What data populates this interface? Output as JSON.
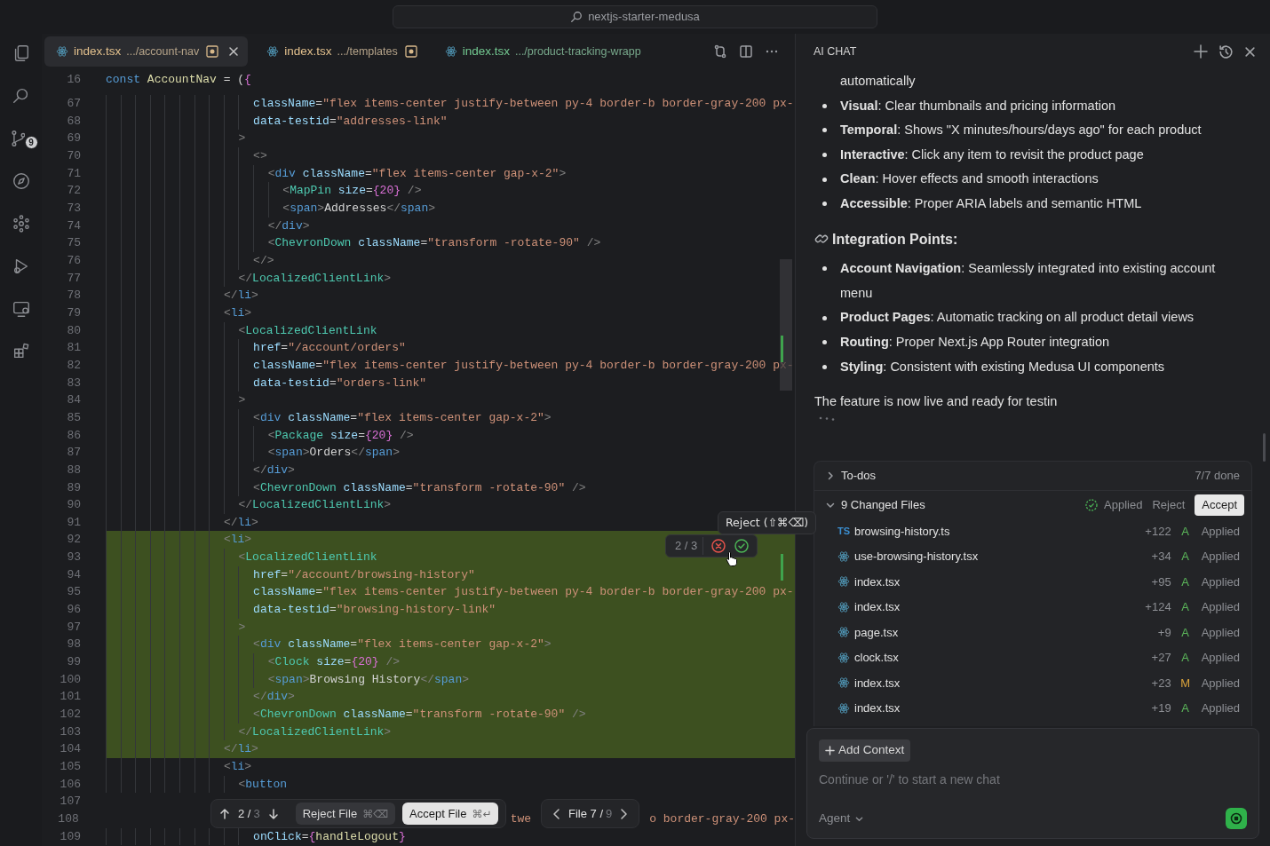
{
  "title_bar": {
    "search": "nextjs-starter-medusa"
  },
  "activity_bar": {
    "source_control_badge": "9"
  },
  "tabs": [
    {
      "name": "index.tsx",
      "path": ".../account-nav",
      "selected": true,
      "dirty": true,
      "color": "#e2c08d"
    },
    {
      "name": "index.tsx",
      "path": ".../templates",
      "selected": false,
      "dirty": true,
      "color": "#e2c08d"
    },
    {
      "name": "index.tsx",
      "path": ".../product-tracking-wrapp",
      "selected": false,
      "dirty": false,
      "color": "#73c991"
    }
  ],
  "editor": {
    "sticky_line": {
      "number": "16",
      "text": "const AccountNav = ({"
    },
    "lines": [
      {
        "number": "67",
        "added": false,
        "text": "                    className=\"flex items-center justify-between py-4 border-b border-gray-200 px-"
      },
      {
        "number": "68",
        "added": false,
        "text": "                    data-testid=\"addresses-link\""
      },
      {
        "number": "69",
        "added": false,
        "text": "                  >"
      },
      {
        "number": "70",
        "added": false,
        "text": "                    <>"
      },
      {
        "number": "71",
        "added": false,
        "text": "                      <div className=\"flex items-center gap-x-2\">"
      },
      {
        "number": "72",
        "added": false,
        "text": "                        <MapPin size={20} />"
      },
      {
        "number": "73",
        "added": false,
        "text": "                        <span>Addresses</span>"
      },
      {
        "number": "74",
        "added": false,
        "text": "                      </div>"
      },
      {
        "number": "75",
        "added": false,
        "text": "                      <ChevronDown className=\"transform -rotate-90\" />"
      },
      {
        "number": "76",
        "added": false,
        "text": "                    </>"
      },
      {
        "number": "77",
        "added": false,
        "text": "                  </LocalizedClientLink>"
      },
      {
        "number": "78",
        "added": false,
        "text": "                </li>"
      },
      {
        "number": "79",
        "added": false,
        "text": "                <li>"
      },
      {
        "number": "80",
        "added": false,
        "text": "                  <LocalizedClientLink"
      },
      {
        "number": "81",
        "added": false,
        "text": "                    href=\"/account/orders\""
      },
      {
        "number": "82",
        "added": false,
        "text": "                    className=\"flex items-center justify-between py-4 border-b border-gray-200 px-"
      },
      {
        "number": "83",
        "added": false,
        "text": "                    data-testid=\"orders-link\""
      },
      {
        "number": "84",
        "added": false,
        "text": "                  >"
      },
      {
        "number": "85",
        "added": false,
        "text": "                    <div className=\"flex items-center gap-x-2\">"
      },
      {
        "number": "86",
        "added": false,
        "text": "                      <Package size={20} />"
      },
      {
        "number": "87",
        "added": false,
        "text": "                      <span>Orders</span>"
      },
      {
        "number": "88",
        "added": false,
        "text": "                    </div>"
      },
      {
        "number": "89",
        "added": false,
        "text": "                    <ChevronDown className=\"transform -rotate-90\" />"
      },
      {
        "number": "90",
        "added": false,
        "text": "                  </LocalizedClientLink>"
      },
      {
        "number": "91",
        "added": false,
        "text": "                </li>"
      },
      {
        "number": "92",
        "added": true,
        "text": "                <li>"
      },
      {
        "number": "93",
        "added": true,
        "text": "                  <LocalizedClientLink"
      },
      {
        "number": "94",
        "added": true,
        "text": "                    href=\"/account/browsing-history\""
      },
      {
        "number": "95",
        "added": true,
        "text": "                    className=\"flex items-center justify-between py-4 border-b border-gray-200 px-"
      },
      {
        "number": "96",
        "added": true,
        "text": "                    data-testid=\"browsing-history-link\""
      },
      {
        "number": "97",
        "added": true,
        "text": "                  >"
      },
      {
        "number": "98",
        "added": true,
        "text": "                    <div className=\"flex items-center gap-x-2\">"
      },
      {
        "number": "99",
        "added": true,
        "text": "                      <Clock size={20} />"
      },
      {
        "number": "100",
        "added": true,
        "text": "                      <span>Browsing History</span>"
      },
      {
        "number": "101",
        "added": true,
        "text": "                    </div>"
      },
      {
        "number": "102",
        "added": true,
        "text": "                    <ChevronDown className=\"transform -rotate-90\" />"
      },
      {
        "number": "103",
        "added": true,
        "text": "                  </LocalizedClientLink>"
      },
      {
        "number": "104",
        "added": true,
        "text": "                </li>"
      },
      {
        "number": "105",
        "added": false,
        "text": "                <li>"
      },
      {
        "number": "106",
        "added": false,
        "text": "                  <button"
      },
      {
        "number": "107",
        "added": false
      },
      {
        "number": "108",
        "added": false,
        "fragments": [
          "twe",
          "o border-gray-200 px-"
        ]
      },
      {
        "number": "109",
        "added": false,
        "text": "                    onClick={handleLogout}"
      }
    ],
    "change_widget": {
      "counter": "2 / 3",
      "tooltip": "Reject (⇧⌘⌫)"
    },
    "review_bar": {
      "position": "2 /",
      "total": "3",
      "reject": "Reject File",
      "reject_shortcut": "⌘⌫",
      "accept": "Accept File",
      "accept_shortcut": "⌘↵",
      "file_position": "File 7 /",
      "file_total": "9"
    }
  },
  "chat": {
    "title": "AI CHAT",
    "blocks": [
      {
        "kind": "continuation",
        "text": "automatically"
      },
      {
        "kind": "bullet",
        "text": "**Visual**: Clear thumbnails and pricing information"
      },
      {
        "kind": "bullet",
        "text": "**Temporal**: Shows \"X minutes/hours/days ago\" for each product"
      },
      {
        "kind": "bullet",
        "text": "**Interactive**: Click any item to revisit the product page"
      },
      {
        "kind": "bullet",
        "text": "**Clean**: Hover effects and smooth interactions"
      },
      {
        "kind": "bullet",
        "text": "**Accessible**: Proper ARIA labels and semantic HTML"
      },
      {
        "kind": "heading",
        "text": "Integration Points:"
      },
      {
        "kind": "bullet",
        "text": "**Account Navigation**: Seamlessly integrated into existing account menu"
      },
      {
        "kind": "bullet",
        "text": "**Product Pages**: Automatic tracking on all product detail views"
      },
      {
        "kind": "bullet",
        "text": "**Routing**: Proper Next.js App Router integration"
      },
      {
        "kind": "bullet",
        "text": "**Styling**: Consistent with existing Medusa UI components"
      },
      {
        "kind": "paragraph",
        "text": "The feature is now live and ready for testin"
      },
      {
        "kind": "typing"
      }
    ],
    "todos": {
      "label": "To-dos",
      "status": "7/7 done",
      "expanded": false
    },
    "changed_files": {
      "label": "9 Changed Files",
      "expanded": true,
      "status": "Applied",
      "reject": "Reject",
      "accept": "Accept",
      "files": [
        {
          "badge": "TS",
          "name": "browsing-history.ts",
          "additions": "+122",
          "change": "A",
          "color": "#5bb65a",
          "result": "Applied"
        },
        {
          "name": "use-browsing-history.tsx",
          "additions": "+34",
          "change": "A",
          "color": "#5bb65a",
          "result": "Applied"
        },
        {
          "name": "index.tsx",
          "additions": "+95",
          "change": "A",
          "color": "#5bb65a",
          "result": "Applied"
        },
        {
          "name": "index.tsx",
          "additions": "+124",
          "change": "A",
          "color": "#5bb65a",
          "result": "Applied"
        },
        {
          "name": "page.tsx",
          "additions": "+9",
          "change": "A",
          "color": "#5bb65a",
          "result": "Applied"
        },
        {
          "name": "clock.tsx",
          "additions": "+27",
          "change": "A",
          "color": "#5bb65a",
          "result": "Applied"
        },
        {
          "name": "index.tsx",
          "additions": "+23",
          "change": "M",
          "color": "#d9a23b",
          "result": "Applied"
        },
        {
          "name": "index.tsx",
          "additions": "+19",
          "change": "A",
          "color": "#5bb65a",
          "result": "Applied"
        }
      ]
    },
    "composer": {
      "add_context": "Add Context",
      "placeholder": "Continue or '/' to start a new chat",
      "mode": "Agent"
    }
  }
}
